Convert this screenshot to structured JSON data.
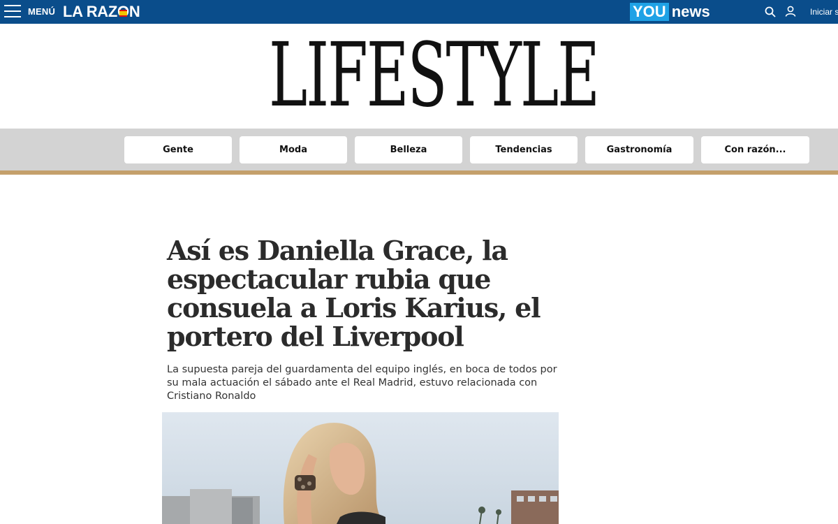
{
  "header": {
    "menu_label": "MENÚ",
    "logo_text_before": "LA RAZ",
    "logo_text_o": "O",
    "logo_text_after": "N",
    "younews_you": "YOU",
    "younews_news": "news",
    "login_label": "Iniciar s",
    "icons": {
      "menu": "hamburger-icon",
      "search": "search-icon",
      "user": "user-icon"
    }
  },
  "section": {
    "title": "LIFESTYLE"
  },
  "nav": {
    "items": [
      {
        "label": "Gente"
      },
      {
        "label": "Moda"
      },
      {
        "label": "Belleza"
      },
      {
        "label": "Tendencias"
      },
      {
        "label": "Gastronomía"
      },
      {
        "label": "Con razón..."
      }
    ]
  },
  "article": {
    "headline": "Así es Daniella Grace, la espectacular rubia que consuela a Loris Karius, el portero del Liverpool",
    "subtitle": "La supuesta pareja del guardamenta del equipo inglés, en boca de todos por su mala actuación el sábado ante el Real Madrid, estuvo relacionada con Cristiano Ronaldo"
  },
  "colors": {
    "topbar": "#0a4d8b",
    "you_badge": "#1fa2e6",
    "nav_background": "#d3d3d3",
    "nav_underline": "#c4a06b",
    "headline": "#2b2b2b"
  }
}
